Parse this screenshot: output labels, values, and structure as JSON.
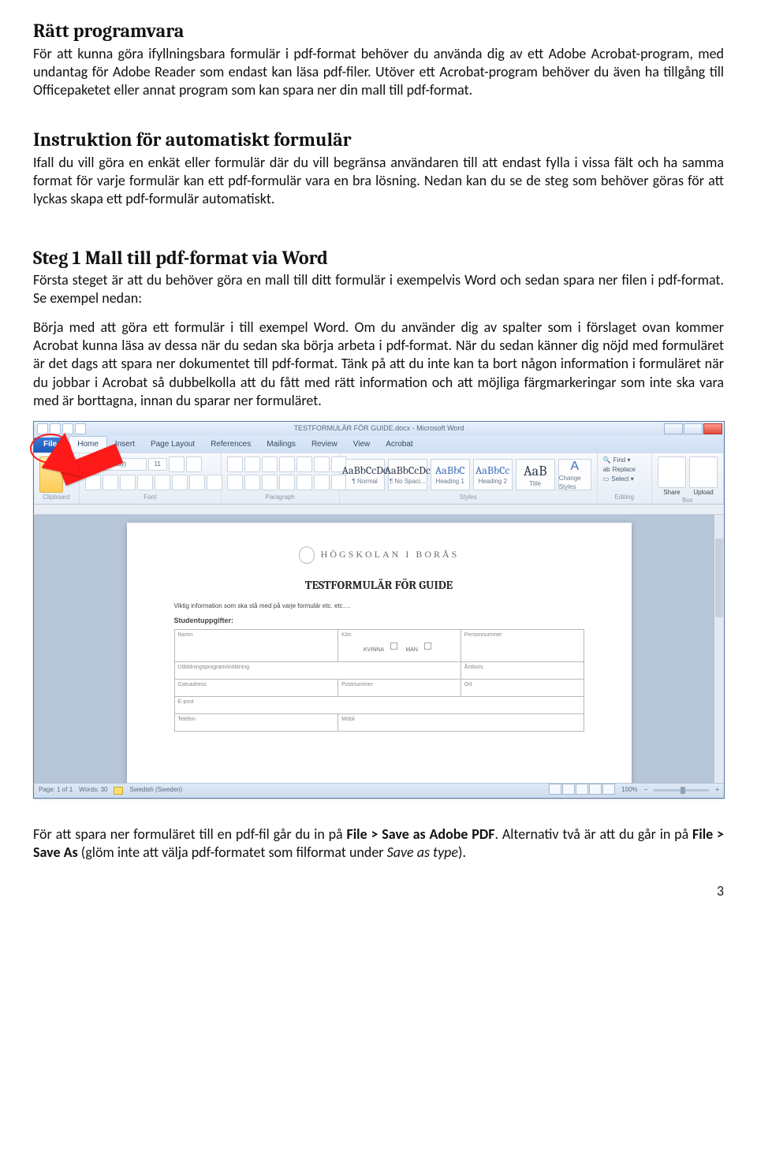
{
  "sections": {
    "s1": {
      "title": "Rätt programvara",
      "p1": "För att kunna göra ifyllningsbara formulär i pdf-format behöver du använda dig av ett Adobe Acrobat-program, med undantag för Adobe Reader som endast kan läsa pdf-filer. Utöver ett Acrobat-program behöver du även ha tillgång till Officepaketet eller annat program som kan spara ner din mall till pdf-format."
    },
    "s2": {
      "title": "Instruktion för automatiskt formulär",
      "p1": "Ifall du vill göra en enkät eller formulär där du vill begränsa användaren till att endast fylla i vissa fält och ha samma format för varje formulär kan ett pdf-formulär vara en bra lösning. Nedan kan du se de steg som behöver göras för att lyckas skapa ett pdf-formulär automatiskt."
    },
    "s3": {
      "title": "Steg 1 Mall till pdf-format via Word",
      "p1": "Första steget är att du behöver göra en mall till ditt formulär i exempelvis Word och sedan spara ner filen i pdf-format. Se exempel nedan:",
      "p2": "Börja med att göra ett formulär i till exempel Word. Om du använder dig av spalter som i förslaget ovan kommer Acrobat kunna läsa av dessa när du sedan ska börja arbeta i pdf-format. När du sedan känner dig nöjd med formuläret är det dags att spara ner dokumentet till pdf-format. Tänk på att du inte kan ta bort någon information i formuläret när du jobbar i Acrobat så dubbelkolla att du fått med rätt information och att möjliga färgmarkeringar som inte ska vara med är borttagna, innan du sparar ner formuläret."
    },
    "after": {
      "p1a": "För att spara ner formuläret till en pdf-fil går du in på ",
      "b1": "File > Save as Adobe PDF",
      "p1b": ". Alternativ två är att du går in på ",
      "b2": "File > Save As",
      "p1c": " (glöm inte att välja pdf-formatet som filformat under ",
      "i1": "Save as type",
      "p1d": ")."
    }
  },
  "word": {
    "title": "TESTFORMULÄR FÖR GUIDE.docx - Microsoft Word",
    "tabs": {
      "file": "File",
      "home": "Home",
      "insert": "Insert",
      "pagelayout": "Page Layout",
      "references": "References",
      "mailings": "Mailings",
      "review": "Review",
      "view": "View",
      "acrobat": "Acrobat"
    },
    "groups": {
      "clipboard": "Clipboard",
      "font": "Font",
      "paragraph": "Paragraph",
      "styles": "Styles",
      "editing": "Editing",
      "box": "Box"
    },
    "font": {
      "name": "Calibri (Body)",
      "size": "11"
    },
    "styles": {
      "normal": "¶ Normal",
      "nospacing": "¶ No Spaci...",
      "h1": "Heading 1",
      "h2": "Heading 2",
      "title": "Title",
      "change": "Change Styles"
    },
    "edit": {
      "find": "Find ▾",
      "replace": "Replace",
      "select": "Select ▾"
    },
    "box": {
      "share": "Share",
      "upload": "Upload"
    },
    "status": {
      "page": "Page: 1 of 1",
      "words": "Words: 30",
      "lang": "Swedish (Sweden)",
      "zoom": "100%"
    },
    "doc": {
      "school": "HÖGSKOLAN I BORÅS",
      "title": "TESTFORMULÄR FÖR GUIDE",
      "info": "Viktig information som ska stå med på varje formulär etc. etc….",
      "sub": "Studentuppgifter:",
      "f": {
        "namn": "Namn",
        "kon": "Kön",
        "kvinna": "KVINNA",
        "man": "MAN",
        "pnr": "Personnummer",
        "prog": "Utbildningsprogram/inriktning",
        "arskurs": "Årskurs",
        "gatu": "Gatuadress",
        "postnr": "Postnummer",
        "ort": "Ort",
        "epost": "E-post",
        "telefon": "Telefon",
        "mobil": "Mobil"
      }
    }
  },
  "page_num": "3"
}
